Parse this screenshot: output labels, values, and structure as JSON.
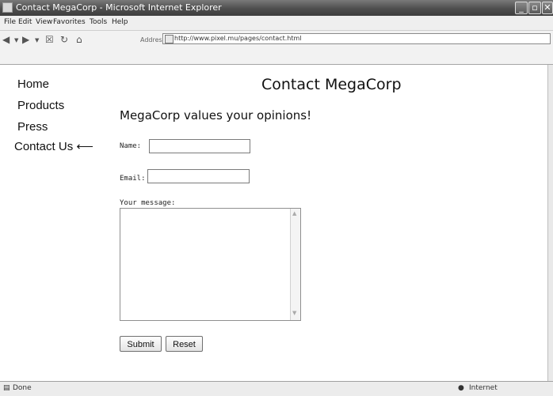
{
  "window": {
    "title": "Contact MegaCorp - Microsoft Internet Explorer",
    "buttons": {
      "minimize": "_",
      "restore": "▫",
      "close": "✕"
    }
  },
  "menubar": {
    "items": [
      "File",
      "Edit",
      "View",
      "Favorites",
      "Tools",
      "Help"
    ]
  },
  "toolbar": {
    "address_label": "Address",
    "url": "http://www.pixel.mu/pages/contact.html"
  },
  "nav": {
    "items": [
      "Home",
      "Products",
      "Press",
      "Contact Us ⟵"
    ]
  },
  "page": {
    "heading": "Contact MegaCorp",
    "subheading": "MegaCorp values your opinions!"
  },
  "form": {
    "name_label": "Name:",
    "email_label": "Email:",
    "message_label": "Your message:",
    "submit_label": "Submit",
    "reset_label": "Reset"
  },
  "status": {
    "left": "Done",
    "zone": "Internet"
  }
}
